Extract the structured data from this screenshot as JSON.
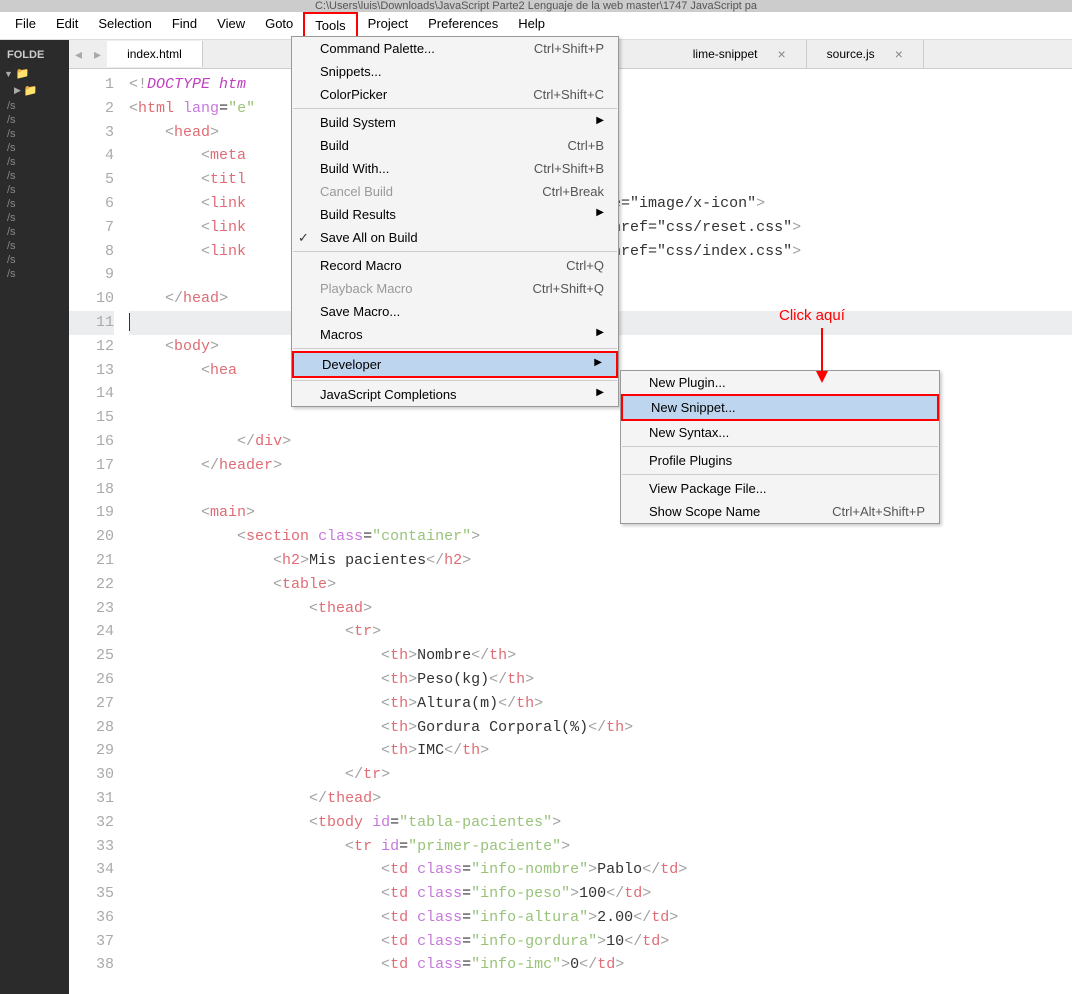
{
  "titlebar": "C:\\Users\\luis\\Downloads\\JavaScript Parte2 Lenguaje de la web master\\1747 JavaScript pa",
  "menubar": [
    "File",
    "Edit",
    "Selection",
    "Find",
    "View",
    "Goto",
    "Tools",
    "Project",
    "Preferences",
    "Help"
  ],
  "sidebar": {
    "title": "FOLDE",
    "items": [
      "/s",
      "/s",
      "/s",
      "/s",
      "/s",
      "/s",
      "/s",
      "/s",
      "/s",
      "/s",
      "/s",
      "/s",
      "/s"
    ]
  },
  "tabs": {
    "active": "index.html",
    "t2": "lime-snippet",
    "t3": "source.js"
  },
  "tools_menu": [
    {
      "label": "Command Palette...",
      "short": "Ctrl+Shift+P"
    },
    {
      "label": "Snippets..."
    },
    {
      "label": "ColorPicker",
      "short": "Ctrl+Shift+C"
    },
    {
      "sep": true
    },
    {
      "label": "Build System",
      "arrow": true
    },
    {
      "label": "Build",
      "short": "Ctrl+B"
    },
    {
      "label": "Build With...",
      "short": "Ctrl+Shift+B"
    },
    {
      "label": "Cancel Build",
      "short": "Ctrl+Break",
      "disabled": true
    },
    {
      "label": "Build Results",
      "arrow": true
    },
    {
      "label": "Save All on Build",
      "checked": true
    },
    {
      "sep": true
    },
    {
      "label": "Record Macro",
      "short": "Ctrl+Q"
    },
    {
      "label": "Playback Macro",
      "short": "Ctrl+Shift+Q",
      "disabled": true
    },
    {
      "label": "Save Macro..."
    },
    {
      "label": "Macros",
      "arrow": true
    },
    {
      "sep": true
    },
    {
      "label": "Developer",
      "arrow": true,
      "highlighted": true,
      "red": true
    },
    {
      "sep": true
    },
    {
      "label": "JavaScript Completions",
      "arrow": true
    }
  ],
  "dev_submenu": [
    {
      "label": "New Plugin..."
    },
    {
      "label": "New Snippet...",
      "highlighted": true,
      "red": true
    },
    {
      "label": "New Syntax..."
    },
    {
      "sep": true
    },
    {
      "label": "Profile Plugins"
    },
    {
      "sep": true
    },
    {
      "label": "View Package File..."
    },
    {
      "label": "Show Scope Name",
      "short": "Ctrl+Alt+Shift+P"
    }
  ],
  "annotation": "Click aquí",
  "code_lines": {
    "1": "<!DOCTYPE htm",
    "2": "<html lang=\"e",
    "3": "    <head>",
    "4": "        <meta",
    "5": "        <titl",
    "6a": "        <link",
    "6b": " type=\"image/x-icon\">",
    "7a": "        <link",
    "7b": "ss\" href=\"css/reset.css\">",
    "8a": "        <link",
    "8b": "ss\" href=\"css/index.css\">",
    "9": "",
    "10": "    </head>",
    "11": "",
    "12": "    <body>",
    "13": "        <hea",
    "14": "",
    "15": "",
    "16": "            </div>",
    "17": "        </header>",
    "18": "",
    "19": "        <main>",
    "20": "            <section class=\"container\">",
    "21": "                <h2>Mis pacientes</h2>",
    "22": "                <table>",
    "23": "                    <thead>",
    "24": "                        <tr>",
    "25": "                            <th>Nombre</th>",
    "26": "                            <th>Peso(kg)</th>",
    "27": "                            <th>Altura(m)</th>",
    "28": "                            <th>Gordura Corporal(%)</th>",
    "29": "                            <th>IMC</th>",
    "30": "                        </tr>",
    "31": "                    </thead>",
    "32": "                    <tbody id=\"tabla-pacientes\">",
    "33": "                        <tr id=\"primer-paciente\">",
    "34": "                            <td class=\"info-nombre\">Pablo</td>",
    "35": "                            <td class=\"info-peso\">100</td>",
    "36": "                            <td class=\"info-altura\">2.00</td>",
    "37": "                            <td class=\"info-gordura\">10</td>",
    "38": "                            <td class=\"info-imc\">0</td>"
  }
}
